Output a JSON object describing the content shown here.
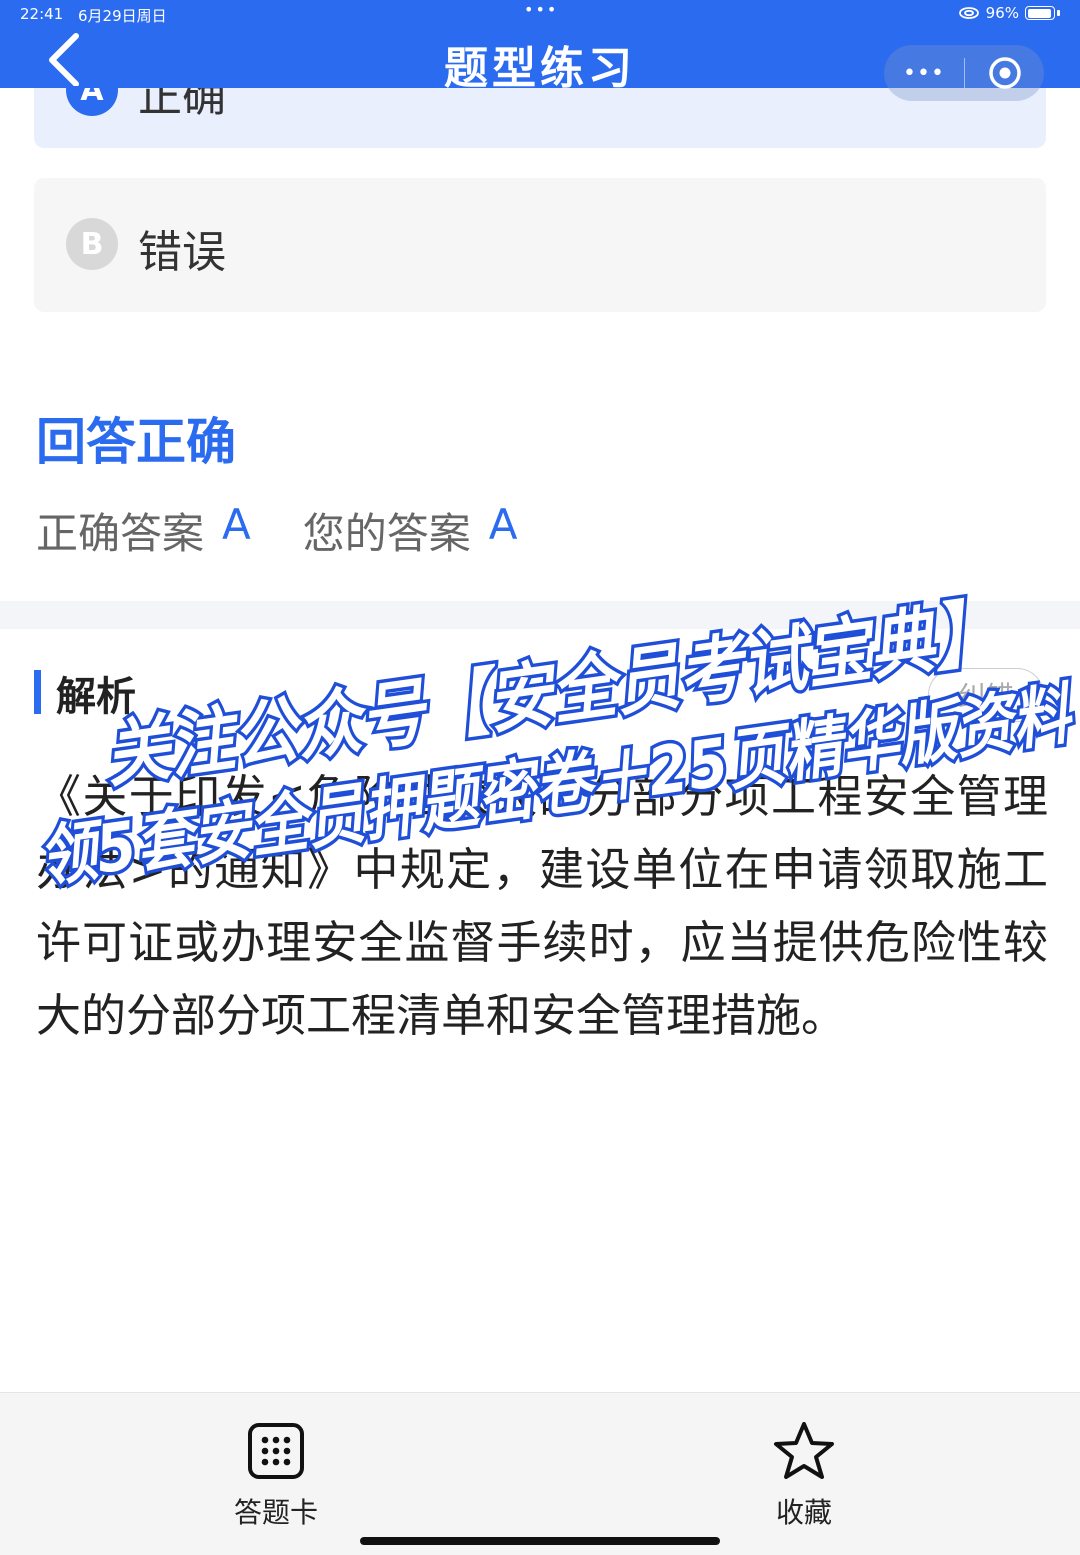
{
  "status_bar": {
    "time": "22:41",
    "date": "6月29日周日",
    "dots": "•••",
    "battery": "96%",
    "battery_level": 0.96
  },
  "header": {
    "title": "题型练习",
    "capsule_more": "•••",
    "color": "#2b6bf0"
  },
  "options": [
    {
      "letter": "A",
      "text": "正确",
      "state": "selected-correct"
    },
    {
      "letter": "B",
      "text": "错误",
      "state": "unselected"
    }
  ],
  "result": {
    "title": "回答正确",
    "correct_label": "正确答案",
    "correct_value": "A",
    "your_label": "您的答案",
    "your_value": "A"
  },
  "analysis": {
    "title": "解析",
    "report_button": "纠错",
    "text": "《关于印发<危险性较大的分部分项工程安全管理办法>的通知》中规定，建设单位在申请领取施工许可证或办理安全监督手续时，应当提供危险性较大的分部分项工程清单和安全管理措施。"
  },
  "watermark": {
    "line1": "关注公众号【安全员考试宝典】",
    "line2": "领5套安全员押题密卷＋25页精华版资料"
  },
  "bottom_bar": {
    "answer_card_label": "答题卡",
    "favorite_label": "收藏"
  }
}
